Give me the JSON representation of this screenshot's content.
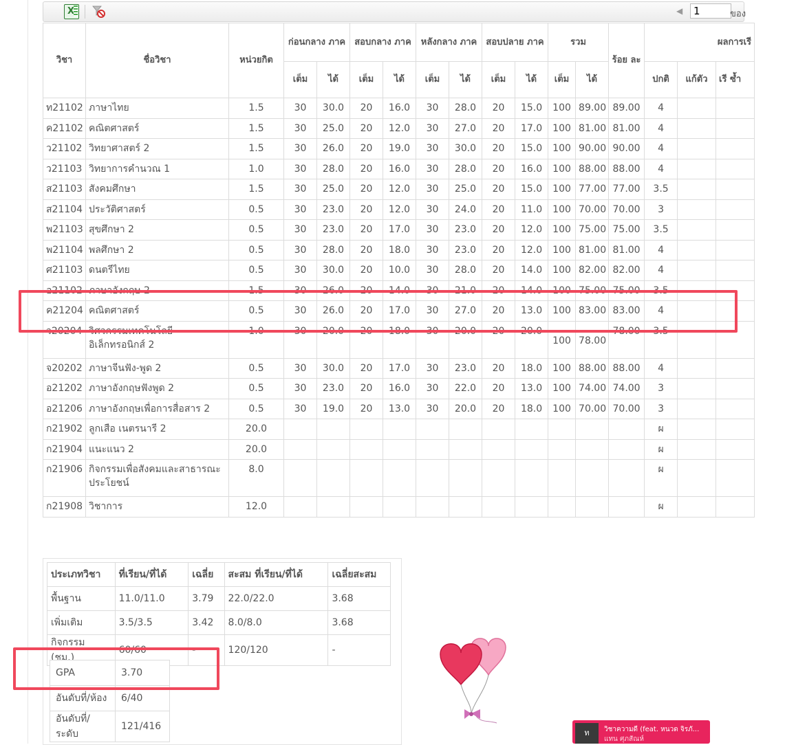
{
  "toolbar": {
    "excel_icon": "excel-export-icon",
    "filter_icon": "clear-filter-icon",
    "page_value": "1",
    "page_of_label": "ของ"
  },
  "table": {
    "headers": {
      "code": "วิชา",
      "name": "ชื่อวิชา",
      "credit": "หน่วยกิต",
      "pre_mid": "ก่อนกลาง ภาค",
      "mid": "สอบกลาง ภาค",
      "post_mid": "หลังกลาง ภาค",
      "final": "สอบปลาย ภาค",
      "total": "รวม",
      "percent": "ร้อย ละ",
      "result": "ผลการเรี",
      "full": "เต็ม",
      "got": "ได้",
      "normal": "ปกติ",
      "fix": "แก้ตัว",
      "repeat": "เรี ซ้ำ"
    },
    "rows": [
      {
        "code": "ท21102",
        "name": "ภาษาไทย",
        "credit": "1.5",
        "c1f": "30",
        "c1g": "30.0",
        "c2f": "20",
        "c2g": "16.0",
        "c3f": "30",
        "c3g": "28.0",
        "c4f": "20",
        "c4g": "15.0",
        "tf": "100",
        "tg": "89.00",
        "pct": "89.00",
        "grade": "4",
        "fix": "",
        "rep": ""
      },
      {
        "code": "ค21102",
        "name": "คณิตศาสตร์",
        "credit": "1.5",
        "c1f": "30",
        "c1g": "25.0",
        "c2f": "20",
        "c2g": "12.0",
        "c3f": "30",
        "c3g": "27.0",
        "c4f": "20",
        "c4g": "17.0",
        "tf": "100",
        "tg": "81.00",
        "pct": "81.00",
        "grade": "4",
        "fix": "",
        "rep": ""
      },
      {
        "code": "ว21102",
        "name": "วิทยาศาสตร์ 2",
        "credit": "1.5",
        "c1f": "30",
        "c1g": "26.0",
        "c2f": "20",
        "c2g": "19.0",
        "c3f": "30",
        "c3g": "30.0",
        "c4f": "20",
        "c4g": "15.0",
        "tf": "100",
        "tg": "90.00",
        "pct": "90.00",
        "grade": "4",
        "fix": "",
        "rep": ""
      },
      {
        "code": "ว21103",
        "name": "วิทยาการคำนวณ 1",
        "credit": "1.0",
        "c1f": "30",
        "c1g": "28.0",
        "c2f": "20",
        "c2g": "16.0",
        "c3f": "30",
        "c3g": "28.0",
        "c4f": "20",
        "c4g": "16.0",
        "tf": "100",
        "tg": "88.00",
        "pct": "88.00",
        "grade": "4",
        "fix": "",
        "rep": ""
      },
      {
        "code": "ส21103",
        "name": "สังคมศึกษา",
        "credit": "1.5",
        "c1f": "30",
        "c1g": "25.0",
        "c2f": "20",
        "c2g": "12.0",
        "c3f": "30",
        "c3g": "25.0",
        "c4f": "20",
        "c4g": "15.0",
        "tf": "100",
        "tg": "77.00",
        "pct": "77.00",
        "grade": "3.5",
        "fix": "",
        "rep": ""
      },
      {
        "code": "ส21104",
        "name": "ประวัติศาสตร์",
        "credit": "0.5",
        "c1f": "30",
        "c1g": "23.0",
        "c2f": "20",
        "c2g": "12.0",
        "c3f": "30",
        "c3g": "24.0",
        "c4f": "20",
        "c4g": "11.0",
        "tf": "100",
        "tg": "70.00",
        "pct": "70.00",
        "grade": "3",
        "fix": "",
        "rep": ""
      },
      {
        "code": "พ21103",
        "name": "สุขศึกษา 2",
        "credit": "0.5",
        "c1f": "30",
        "c1g": "23.0",
        "c2f": "20",
        "c2g": "17.0",
        "c3f": "30",
        "c3g": "23.0",
        "c4f": "20",
        "c4g": "12.0",
        "tf": "100",
        "tg": "75.00",
        "pct": "75.00",
        "grade": "3.5",
        "fix": "",
        "rep": ""
      },
      {
        "code": "พ21104",
        "name": "พลศึกษา 2",
        "credit": "0.5",
        "c1f": "30",
        "c1g": "28.0",
        "c2f": "20",
        "c2g": "18.0",
        "c3f": "30",
        "c3g": "23.0",
        "c4f": "20",
        "c4g": "12.0",
        "tf": "100",
        "tg": "81.00",
        "pct": "81.00",
        "grade": "4",
        "fix": "",
        "rep": ""
      },
      {
        "code": "ศ21103",
        "name": "ดนตรีไทย",
        "credit": "0.5",
        "c1f": "30",
        "c1g": "30.0",
        "c2f": "20",
        "c2g": "10.0",
        "c3f": "30",
        "c3g": "28.0",
        "c4f": "20",
        "c4g": "14.0",
        "tf": "100",
        "tg": "82.00",
        "pct": "82.00",
        "grade": "4",
        "fix": "",
        "rep": ""
      },
      {
        "code": "อ21102",
        "name": "ภาษาอังกฤษ 2",
        "credit": "1.5",
        "c1f": "30",
        "c1g": "26.0",
        "c2f": "20",
        "c2g": "14.0",
        "c3f": "30",
        "c3g": "21.0",
        "c4f": "20",
        "c4g": "14.0",
        "tf": "100",
        "tg": "75.00",
        "pct": "75.00",
        "grade": "3.5",
        "fix": "",
        "rep": ""
      },
      {
        "code": "ค21204",
        "name": "คณิตศาสตร์",
        "credit": "0.5",
        "c1f": "30",
        "c1g": "26.0",
        "c2f": "20",
        "c2g": "17.0",
        "c3f": "30",
        "c3g": "27.0",
        "c4f": "20",
        "c4g": "13.0",
        "tf": "100",
        "tg": "83.00",
        "pct": "83.00",
        "grade": "4",
        "fix": "",
        "rep": ""
      },
      {
        "code": "ว20204",
        "name": "วิศวกรรมเทคโนโลยีอิเล็กทรอนิกส์ 2",
        "credit": "1.0",
        "c1f": "30",
        "c1g": "20.0",
        "c2f": "20",
        "c2g": "18.0",
        "c3f": "30",
        "c3g": "20.0",
        "c4f": "20",
        "c4g": "20.0",
        "tf": "100",
        "tg": "78.00",
        "pct": "78.00",
        "grade": "3.5",
        "fix": "",
        "rep": "",
        "tall": true
      },
      {
        "code": "จ20202",
        "name": "ภาษาจีนฟัง-พูด 2",
        "credit": "0.5",
        "c1f": "30",
        "c1g": "30.0",
        "c2f": "20",
        "c2g": "17.0",
        "c3f": "30",
        "c3g": "23.0",
        "c4f": "20",
        "c4g": "18.0",
        "tf": "100",
        "tg": "88.00",
        "pct": "88.00",
        "grade": "4",
        "fix": "",
        "rep": ""
      },
      {
        "code": "อ21202",
        "name": "ภาษาอังกฤษฟังพูด 2",
        "credit": "0.5",
        "c1f": "30",
        "c1g": "23.0",
        "c2f": "20",
        "c2g": "16.0",
        "c3f": "30",
        "c3g": "22.0",
        "c4f": "20",
        "c4g": "13.0",
        "tf": "100",
        "tg": "74.00",
        "pct": "74.00",
        "grade": "3",
        "fix": "",
        "rep": ""
      },
      {
        "code": "อ21206",
        "name": "ภาษาอังกฤษเพื่อการสื่อสาร 2",
        "credit": "0.5",
        "c1f": "30",
        "c1g": "19.0",
        "c2f": "20",
        "c2g": "13.0",
        "c3f": "30",
        "c3g": "20.0",
        "c4f": "20",
        "c4g": "18.0",
        "tf": "100",
        "tg": "70.00",
        "pct": "70.00",
        "grade": "3",
        "fix": "",
        "rep": ""
      },
      {
        "code": "ก21902",
        "name": "ลูกเสือ เนตรนารี 2",
        "credit": "20.0",
        "c1f": "",
        "c1g": "",
        "c2f": "",
        "c2g": "",
        "c3f": "",
        "c3g": "",
        "c4f": "",
        "c4g": "",
        "tf": "",
        "tg": "",
        "pct": "",
        "grade": "ผ",
        "fix": "",
        "rep": ""
      },
      {
        "code": "ก21904",
        "name": "แนะแนว 2",
        "credit": "20.0",
        "c1f": "",
        "c1g": "",
        "c2f": "",
        "c2g": "",
        "c3f": "",
        "c3g": "",
        "c4f": "",
        "c4g": "",
        "tf": "",
        "tg": "",
        "pct": "",
        "grade": "ผ",
        "fix": "",
        "rep": ""
      },
      {
        "code": "ก21906",
        "name": "กิจกรรมเพื่อสังคมและสาธารณะประโยชน์",
        "credit": "8.0",
        "c1f": "",
        "c1g": "",
        "c2f": "",
        "c2g": "",
        "c3f": "",
        "c3g": "",
        "c4f": "",
        "c4g": "",
        "tf": "",
        "tg": "",
        "pct": "",
        "grade": "ผ",
        "fix": "",
        "rep": "",
        "tall": true
      },
      {
        "code": "ก21908",
        "name": "วิชาการ",
        "credit": "12.0",
        "c1f": "",
        "c1g": "",
        "c2f": "",
        "c2g": "",
        "c3f": "",
        "c3g": "",
        "c4f": "",
        "c4g": "",
        "tf": "",
        "tg": "",
        "pct": "",
        "grade": "ผ",
        "fix": "",
        "rep": ""
      }
    ]
  },
  "summary": {
    "headers": [
      "ประเภทวิชา",
      "ที่เรียน/ที่ได้",
      "เฉลี่ย",
      "สะสม ที่เรียน/ที่ได้",
      "เฉลี่ยสะสม"
    ],
    "rows": [
      [
        "พื้นฐาน",
        "11.0/11.0",
        "3.79",
        "22.0/22.0",
        "3.68"
      ],
      [
        "เพิ่มเติม",
        "3.5/3.5",
        "3.42",
        "8.0/8.0",
        "3.68"
      ],
      [
        "กิจกรรม (ชม.)",
        "60/60",
        "-",
        "120/120",
        "-"
      ]
    ]
  },
  "gpa": {
    "rows": [
      [
        "GPA",
        "3.70"
      ],
      [
        "อันดับที่/ห้อง",
        "6/40"
      ],
      [
        "อันดับที่/ระดับ",
        "121/416"
      ]
    ]
  },
  "music": {
    "title": "วิชาความดี (feat. หนวด จิรภั...",
    "artist": "แทน ศุภสัณห์",
    "thumb": "ท"
  },
  "colors": {
    "highlight": "#f0485c",
    "music_bg": "#e8245d"
  }
}
